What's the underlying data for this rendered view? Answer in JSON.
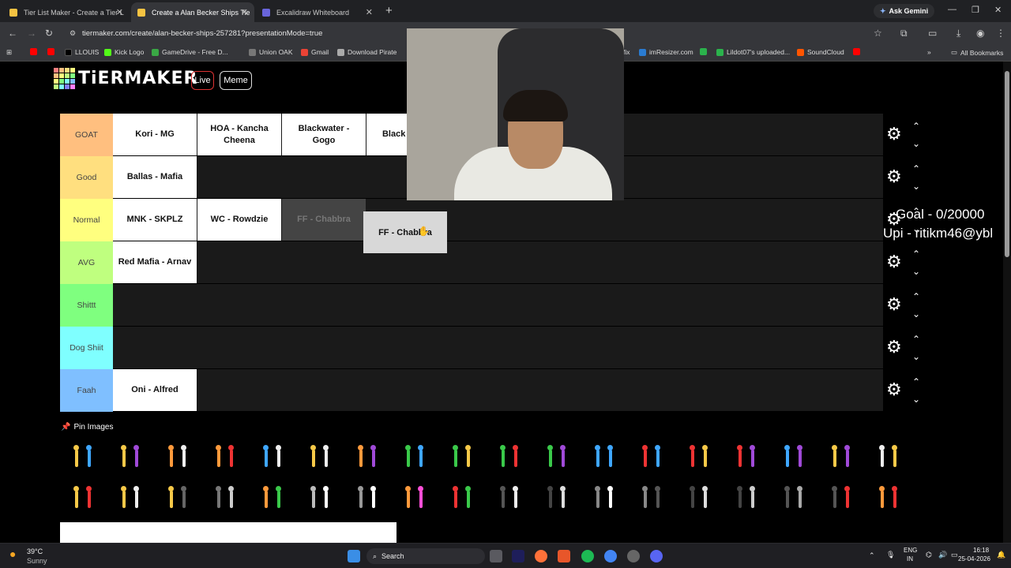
{
  "browser": {
    "tabs": [
      {
        "title": "Tier List Maker - Create a Tier L",
        "active": false
      },
      {
        "title": "Create a Alan Becker Ships Tie",
        "active": true
      },
      {
        "title": "Excalidraw Whiteboard",
        "active": false
      }
    ],
    "ask_gemini": "Ask Gemini",
    "url": "tiermaker.com/create/alan-becker-ships-257281?presentationMode=true",
    "bookmarks": [
      {
        "label": "LLOUIS",
        "color": "#3a3a3a"
      },
      {
        "label": "Kick Logo",
        "color": "#53fc18"
      },
      {
        "label": "GameDrive - Free D...",
        "color": "#3aa845"
      },
      {
        "label": "Union OAK",
        "color": "#888"
      },
      {
        "label": "Gmail",
        "color": "#ea4335"
      },
      {
        "label": "Download Pirate",
        "color": "#aaa"
      },
      {
        "label": "fix",
        "color": "#999"
      },
      {
        "label": "imResizer.com",
        "color": "#2a7bd1"
      },
      {
        "label": "Lildot07's uploaded...",
        "color": "#2bb24c"
      },
      {
        "label": "SoundCloud",
        "color": "#ff5500"
      }
    ],
    "all_bookmarks": "All Bookmarks"
  },
  "header": {
    "logo_text": "TiERMAKER",
    "live_label": "Live",
    "meme_label": "Meme"
  },
  "tiers": [
    {
      "label": "GOAT",
      "color": "#ffbf7f",
      "items": [
        "Kori - MG",
        "HOA - Kancha Cheena",
        "Blackwater - Gogo",
        "Black Kanch"
      ]
    },
    {
      "label": "Good",
      "color": "#ffdf7f",
      "items": [
        "Ballas - Mafia"
      ]
    },
    {
      "label": "Normal",
      "color": "#ffff7f",
      "items": [
        "MNK - SKPLZ",
        "WC - Rowdzie",
        "FF - Chabbra"
      ]
    },
    {
      "label": "AVG",
      "color": "#bfff7f",
      "items": [
        "Red Mafia - Arnav"
      ]
    },
    {
      "label": "Shittt",
      "color": "#7fff7f",
      "items": []
    },
    {
      "label": "Dog Shiit",
      "color": "#7fffff",
      "items": []
    },
    {
      "label": "Faah",
      "color": "#7fbfff",
      "items": [
        "Oni - Alfred"
      ]
    }
  ],
  "dragged_item": "FF - Chabbra",
  "overlay": {
    "goal": "Goal - 0/20000",
    "upi": "Upi - ritikm46@ybl"
  },
  "pin_images_label": "Pin Images",
  "taskbar": {
    "weather_temp": "39°C",
    "weather_desc": "Sunny",
    "search": "Search",
    "lang": "ENG",
    "region": "IN",
    "time": "16:18",
    "date": "25-04-2026"
  }
}
